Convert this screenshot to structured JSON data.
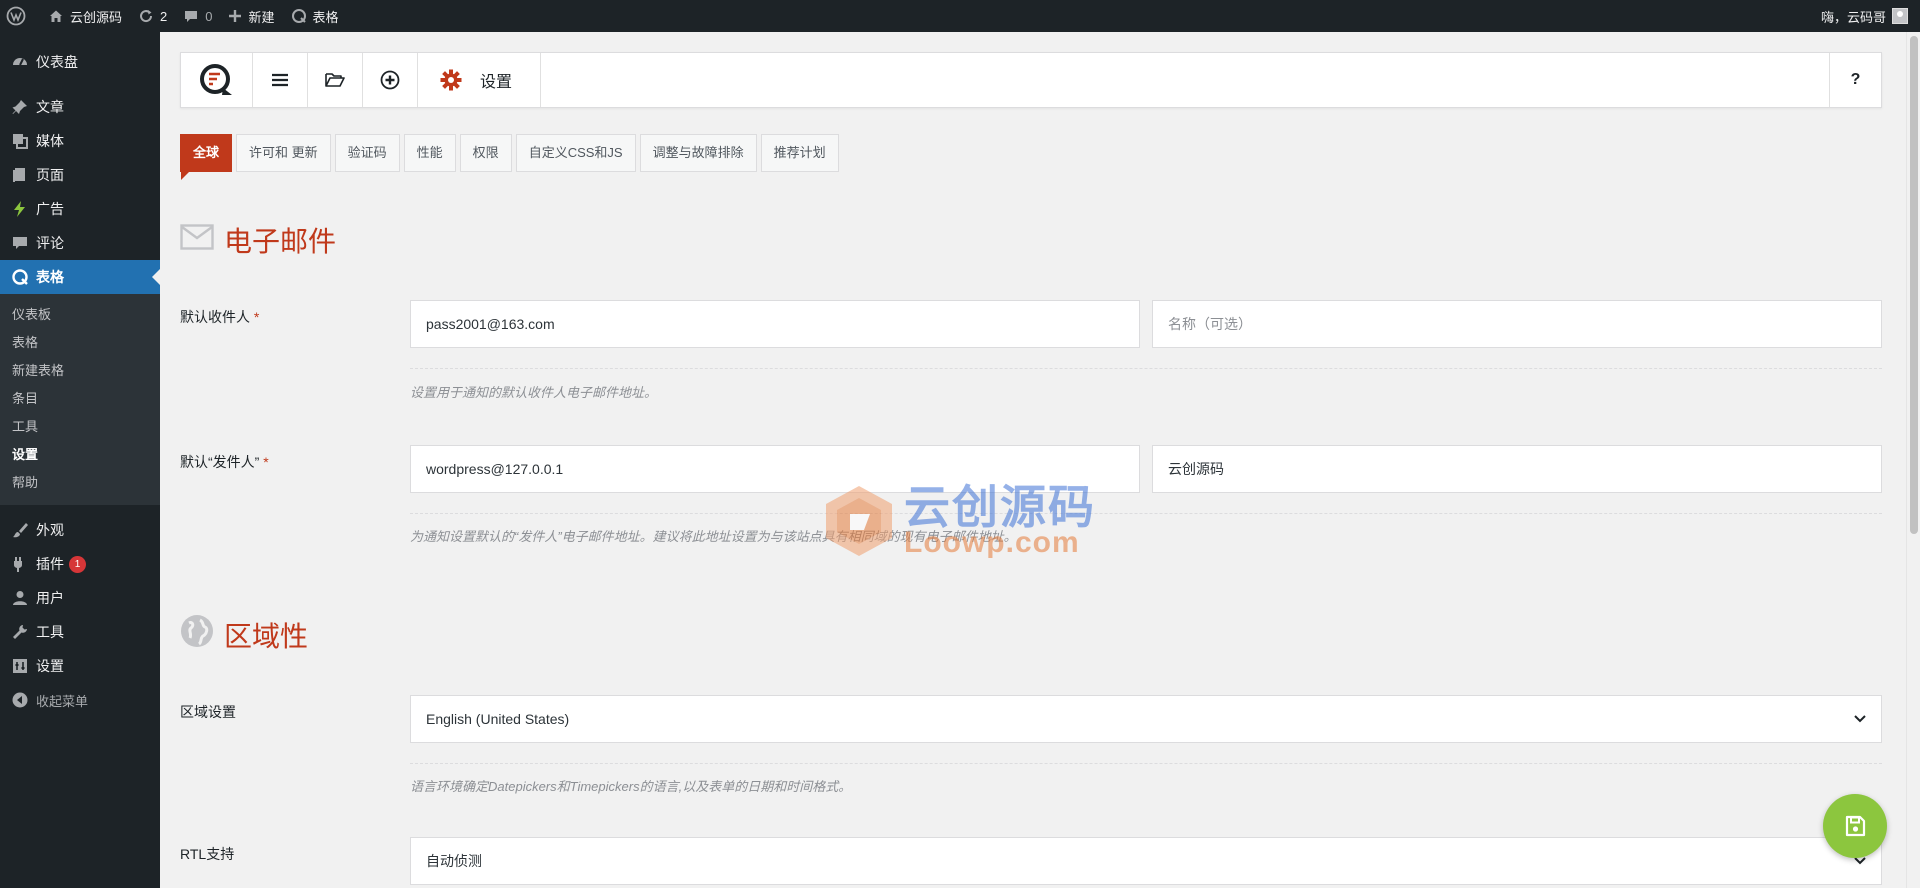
{
  "adminbar": {
    "site_name": "云创源码",
    "updates_count": "2",
    "comments_count": "0",
    "new_label": "新建",
    "forms_label": "表格",
    "greeting": "嗨，云码哥"
  },
  "sidebar": {
    "items": [
      {
        "label": "仪表盘",
        "icon": "dashboard-icon"
      },
      {
        "label": "文章",
        "icon": "pushpin-icon"
      },
      {
        "label": "媒体",
        "icon": "media-icon"
      },
      {
        "label": "页面",
        "icon": "pages-icon"
      },
      {
        "label": "广告",
        "icon": "lightning-icon"
      },
      {
        "label": "评论",
        "icon": "comment-icon"
      },
      {
        "label": "表格",
        "icon": "forms-icon"
      },
      {
        "label": "外观",
        "icon": "paintbrush-icon"
      },
      {
        "label": "插件",
        "icon": "plugin-icon",
        "badge": "1"
      },
      {
        "label": "用户",
        "icon": "user-icon"
      },
      {
        "label": "工具",
        "icon": "wrench-icon"
      },
      {
        "label": "设置",
        "icon": "settings-icon"
      },
      {
        "label": "收起菜单",
        "icon": "collapse-icon"
      }
    ],
    "submenu": [
      "仪表板",
      "表格",
      "新建表格",
      "条目",
      "工具",
      "设置",
      "帮助"
    ]
  },
  "toolbar": {
    "settings_label": "设置",
    "help_label": "?"
  },
  "tabs": [
    "全球",
    "许可和 更新",
    "验证码",
    "性能",
    "权限",
    "自定义CSS和JS",
    "调整与故障排除",
    "推荐计划"
  ],
  "email_section": {
    "title": "电子邮件",
    "recipient_label": "默认收件人",
    "recipient_value": "pass2001@163.com",
    "recipient_name_placeholder": "名称（可选）",
    "recipient_help": "设置用于通知的默认收件人电子邮件地址。",
    "from_label": "默认“发件人”",
    "from_value": "wordpress@127.0.0.1",
    "from_name_value": "云创源码",
    "from_help": "为通知设置默认的“发件人”电子邮件地址。建议将此地址设置为与该站点具有相同域的现有电子邮件地址。"
  },
  "locale_section": {
    "title": "区域性",
    "locale_label": "区域设置",
    "locale_value": "English (United States)",
    "locale_help": "语言环境确定Datepickers和Timepickers的语言,以及表单的日期和时间格式。",
    "rtl_label": "RTL支持",
    "rtl_value": "自动侦测"
  },
  "watermark": {
    "cn": "云创源码",
    "en": "Loowp.com"
  },
  "colors": {
    "accent": "#c0391b",
    "wp_blue": "#2271b1",
    "save_green": "#8cc63e"
  }
}
